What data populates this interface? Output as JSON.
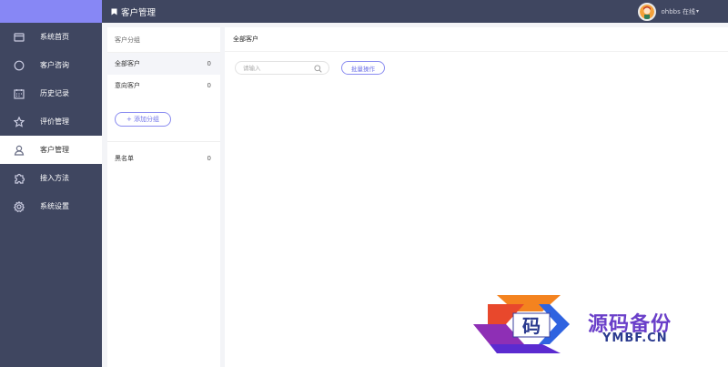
{
  "topbar": {
    "title": "客户管理",
    "user_name": "ohbbs 在线",
    "caret": "▾"
  },
  "sidebar": {
    "items": [
      {
        "label": "系统首页",
        "icon": "window-icon",
        "active": false
      },
      {
        "label": "客户咨询",
        "icon": "chat-circle-icon",
        "active": false
      },
      {
        "label": "历史记录",
        "icon": "calendar-icon",
        "active": false
      },
      {
        "label": "评价管理",
        "icon": "star-icon",
        "active": false
      },
      {
        "label": "客户管理",
        "icon": "user-icon",
        "active": true
      },
      {
        "label": "接入方法",
        "icon": "puzzle-icon",
        "active": false
      },
      {
        "label": "系统设置",
        "icon": "gear-icon",
        "active": false
      }
    ]
  },
  "groups": {
    "header": "客户分组",
    "items": [
      {
        "name": "全部客户",
        "count": "0",
        "active": true
      },
      {
        "name": "意向客户",
        "count": "0",
        "active": false
      }
    ],
    "add_label": "+ 添加分组",
    "blacklist": {
      "name": "黑名单",
      "count": "0"
    }
  },
  "main": {
    "title": "全部客户",
    "search_placeholder": "请输入",
    "batch_label": "批量操作"
  },
  "watermark": {
    "badge_char": "码",
    "title": "源码备份",
    "domain": "YMBF.CN"
  },
  "colors": {
    "sidebar_bg": "#3f4660",
    "brand": "#8787f5",
    "accent": "#6f72e8"
  }
}
